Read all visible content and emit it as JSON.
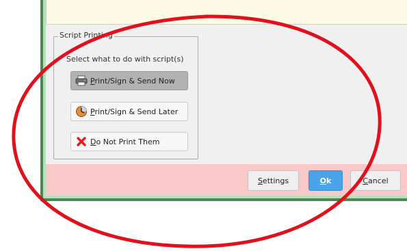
{
  "script_printing": {
    "group_title": "Script Printing",
    "description": "Select what to do with script(s)",
    "options": [
      {
        "label_mnemonic": "P",
        "label_rest": "rint/Sign & Send Now",
        "icon": "printer-icon",
        "selected": true
      },
      {
        "label_mnemonic": "P",
        "label_rest": "rint/Sign & Send Later",
        "icon": "clock-icon",
        "selected": false
      },
      {
        "label_mnemonic": "D",
        "label_rest": "o Not Print Them",
        "icon": "red-x-icon",
        "selected": false
      }
    ]
  },
  "footer": {
    "settings": {
      "mnemonic": "S",
      "rest": "ettings"
    },
    "ok": {
      "mnemonic": "O",
      "rest": "k"
    },
    "cancel": {
      "mnemonic": "C",
      "rest": "ancel"
    }
  },
  "colors": {
    "notice_bar": "#fdfbe3",
    "footer": "#f9c8c8",
    "ok_button": "#4aa3e6",
    "annotation": "#e0101c",
    "frame": "#4a8a52"
  },
  "annotation": {
    "shape": "ellipse",
    "color": "red"
  }
}
